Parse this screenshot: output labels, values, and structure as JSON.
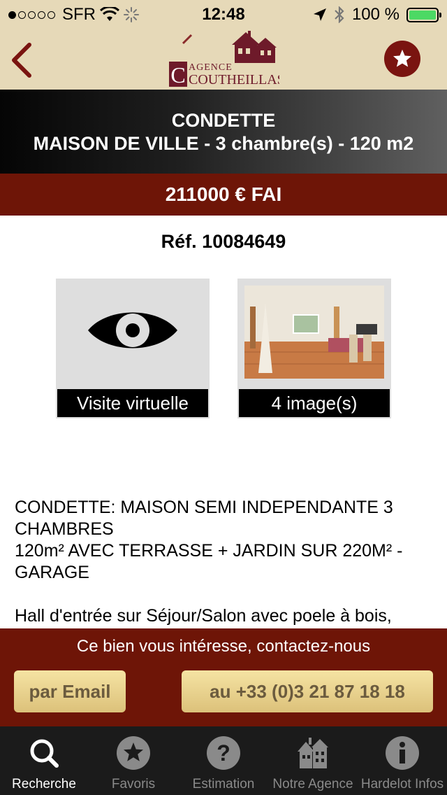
{
  "status_bar": {
    "carrier": "SFR",
    "time": "12:48",
    "battery": "100 %",
    "battery_level": 1.0
  },
  "header": {
    "logo": {
      "line1": "AGENCE",
      "line2": "COUTHEILLAS"
    },
    "back_icon": "chevron-left-icon",
    "favorite_icon": "star-icon"
  },
  "listing": {
    "city": "CONDETTE",
    "subtitle": "MAISON DE VILLE - 3 chambre(s) - 120 m2",
    "price": "211000 € FAI",
    "reference": "Réf. 10084649"
  },
  "media": {
    "virtual_tour_label": "Visite virtuelle",
    "images_label": "4 image(s)"
  },
  "description": {
    "line1": "CONDETTE: MAISON SEMI INDEPENDANTE 3",
    "line2": "CHAMBRES",
    "line3": "120m² AVEC TERRASSE + JARDIN SUR 220M² -",
    "line4": "GARAGE",
    "line5": "Hall d'entrée sur Séjour/Salon avec poele à bois,"
  },
  "contact": {
    "prompt": "Ce bien vous intéresse, contactez-nous",
    "email_label": "par Email",
    "phone_label": "au +33 (0)3 21 87 18 18"
  },
  "tabs": [
    {
      "label": "Recherche",
      "icon": "search-icon",
      "active": true
    },
    {
      "label": "Favoris",
      "icon": "star-icon",
      "active": false
    },
    {
      "label": "Estimation",
      "icon": "question-icon",
      "active": false
    },
    {
      "label": "Notre Agence",
      "icon": "house-icon",
      "active": false
    },
    {
      "label": "Hardelot Infos",
      "icon": "info-icon",
      "active": false
    }
  ],
  "colors": {
    "header_bg": "#e6d9b8",
    "brand_red": "#6e1507",
    "button_gold": "#dcc17a"
  }
}
